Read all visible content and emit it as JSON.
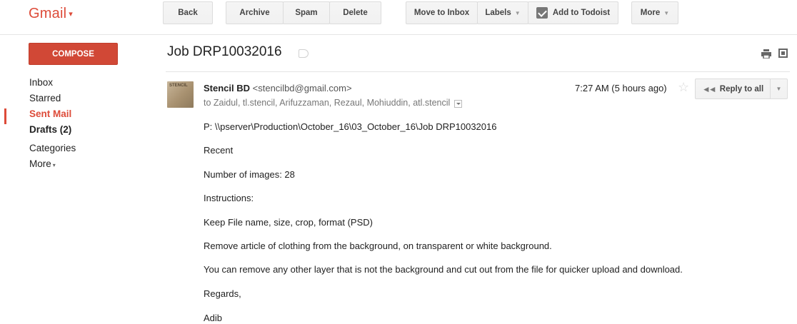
{
  "app": {
    "logo": "Gmail",
    "logo_caret": "▾"
  },
  "toolbar": {
    "back": "Back",
    "archive": "Archive",
    "spam": "Spam",
    "delete": "Delete",
    "move_to_inbox": "Move to Inbox",
    "labels": "Labels",
    "add_to_todoist": "Add to Todoist",
    "more": "More",
    "dropdown_caret": "▼"
  },
  "sidebar": {
    "compose": "COMPOSE",
    "items": [
      {
        "label": "Inbox"
      },
      {
        "label": "Starred"
      },
      {
        "label": "Sent Mail",
        "active": true
      },
      {
        "label": "Drafts (2)"
      },
      {
        "label": "Categories"
      },
      {
        "label": "More",
        "caret": "▾"
      }
    ]
  },
  "conversation": {
    "subject": "Job DRP10032016",
    "message": {
      "avatar_text": "STENCIL",
      "sender_name": "Stencil BD",
      "sender_email": "<stencilbd@gmail.com>",
      "recipients": "to Zaidul, tl.stencil, Arifuzzaman, Rezaul, Mohiuddin, atl.stencil",
      "time": "7:27 AM (5 hours ago)",
      "star": "☆",
      "reply_all": "Reply to all",
      "reply_arrows": "◄◄",
      "more_caret": "▼",
      "body": [
        "P: \\\\pserver\\Production\\October_16\\03_October_16\\Job DRP10032016",
        "Recent",
        "Number of images: 28",
        "Instructions:",
        "Keep File name, size, crop, format (PSD)",
        "Remove article of clothing from the background, on transparent or white background.",
        "You can remove any other layer that is not the background and cut out from the file for quicker upload and download.",
        "Regards,",
        "Adib"
      ]
    }
  },
  "colors": {
    "brand_red": "#dd4b39",
    "compose_red": "#d14836",
    "button_bg": "#f5f5f5",
    "divider": "#e5e5e5"
  },
  "icons": [
    "print-icon",
    "new-window-icon",
    "label-tag-icon",
    "todoist-icon",
    "star-icon",
    "reply-all-icon"
  ]
}
